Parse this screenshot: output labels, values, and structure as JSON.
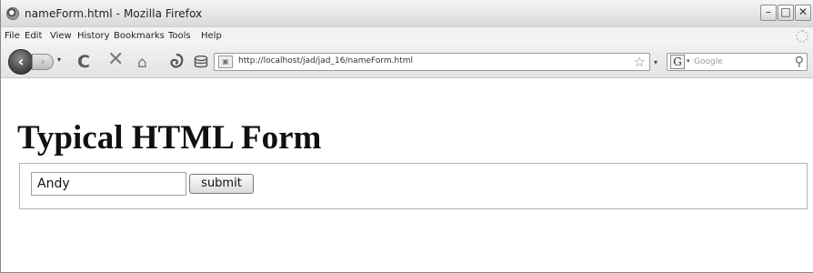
{
  "window": {
    "title": "nameForm.html - Mozilla Firefox",
    "controls": {
      "minimize": "–",
      "maximize": "□",
      "close": "✕"
    }
  },
  "menu": {
    "items": [
      {
        "label": "File"
      },
      {
        "label": "Edit"
      },
      {
        "label": "View"
      },
      {
        "label": "History"
      },
      {
        "label": "Bookmarks"
      },
      {
        "label": "Tools"
      },
      {
        "label": "Help"
      }
    ]
  },
  "toolbar": {
    "back_glyph": "‹",
    "forward_glyph": "›",
    "dropdown_glyph": "▾",
    "reload_glyph": "C",
    "stop_glyph": "✕",
    "home_glyph": "⌂",
    "url": "http://localhost/jad/jad_16/nameForm.html",
    "bookmark_star": "☆",
    "search_engine_letter": "G",
    "search_placeholder": "Google",
    "search_go_glyph": "⚲"
  },
  "page": {
    "heading": "Typical HTML Form",
    "form": {
      "name_value": "Andy",
      "submit_label": "submit"
    }
  },
  "colors": {
    "titlebar": "#e4e4e4",
    "page_bg": "#ffffff",
    "form_border": "#b4b4b4"
  }
}
